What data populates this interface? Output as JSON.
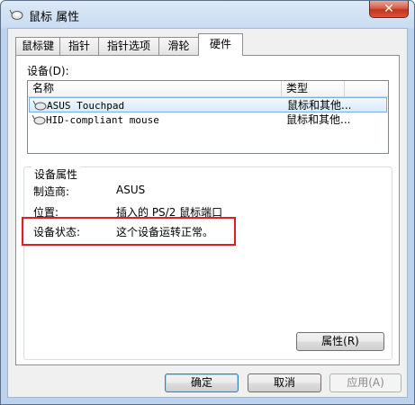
{
  "window": {
    "title": "鼠标 属性",
    "close_glyph": "✕"
  },
  "tabs": [
    {
      "label": "鼠标键",
      "active": false
    },
    {
      "label": "指针",
      "active": false
    },
    {
      "label": "指针选项",
      "active": false
    },
    {
      "label": "滑轮",
      "active": false
    },
    {
      "label": "硬件",
      "active": true
    }
  ],
  "devices": {
    "label": "设备(D):",
    "columns": {
      "name": "名称",
      "type": "类型"
    },
    "rows": [
      {
        "name": "ASUS Touchpad",
        "type": "鼠标和其他...",
        "selected": true
      },
      {
        "name": "HID-compliant mouse",
        "type": "鼠标和其他...",
        "selected": false
      }
    ]
  },
  "properties": {
    "group_title": "设备属性",
    "manufacturer_label": "制造商:",
    "manufacturer_value": "ASUS",
    "location_label": "位置:",
    "location_value": "插入的 PS/2 鼠标端口",
    "status_label": "设备状态:",
    "status_value": "这个设备运转正常。",
    "properties_button": "属性(R)"
  },
  "buttons": {
    "ok": "确定",
    "cancel": "取消",
    "apply": "应用(A)"
  },
  "icons": {
    "title": "mouse-icon",
    "device": "mouse-icon"
  },
  "colors": {
    "highlight": "#e02020",
    "selection": "#d7eaf9",
    "close": "#c2331c"
  }
}
